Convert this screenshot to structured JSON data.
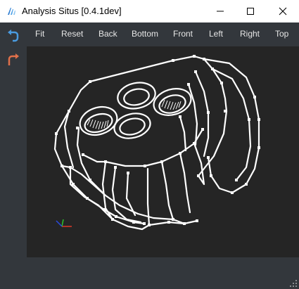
{
  "window": {
    "title": "Analysis Situs [0.4.1dev]",
    "controls": [
      "minimize",
      "maximize",
      "close"
    ]
  },
  "toolbar": {
    "buttons": [
      {
        "label": "Fit"
      },
      {
        "label": "Reset"
      },
      {
        "label": "Back"
      },
      {
        "label": "Bottom"
      },
      {
        "label": "Front"
      },
      {
        "label": "Left"
      },
      {
        "label": "Right"
      },
      {
        "label": "Top"
      }
    ]
  },
  "sidebar": {
    "icons": [
      {
        "name": "undo-icon",
        "color": "#4a9be0"
      },
      {
        "name": "redo-icon",
        "color": "#e0704a"
      }
    ]
  },
  "viewport": {
    "background": "#252525",
    "model_color": "#ffffff",
    "axes": {
      "x_color": "#e03a2a",
      "y_color": "#2ec42e",
      "z_color": "#2a4ae0"
    }
  }
}
